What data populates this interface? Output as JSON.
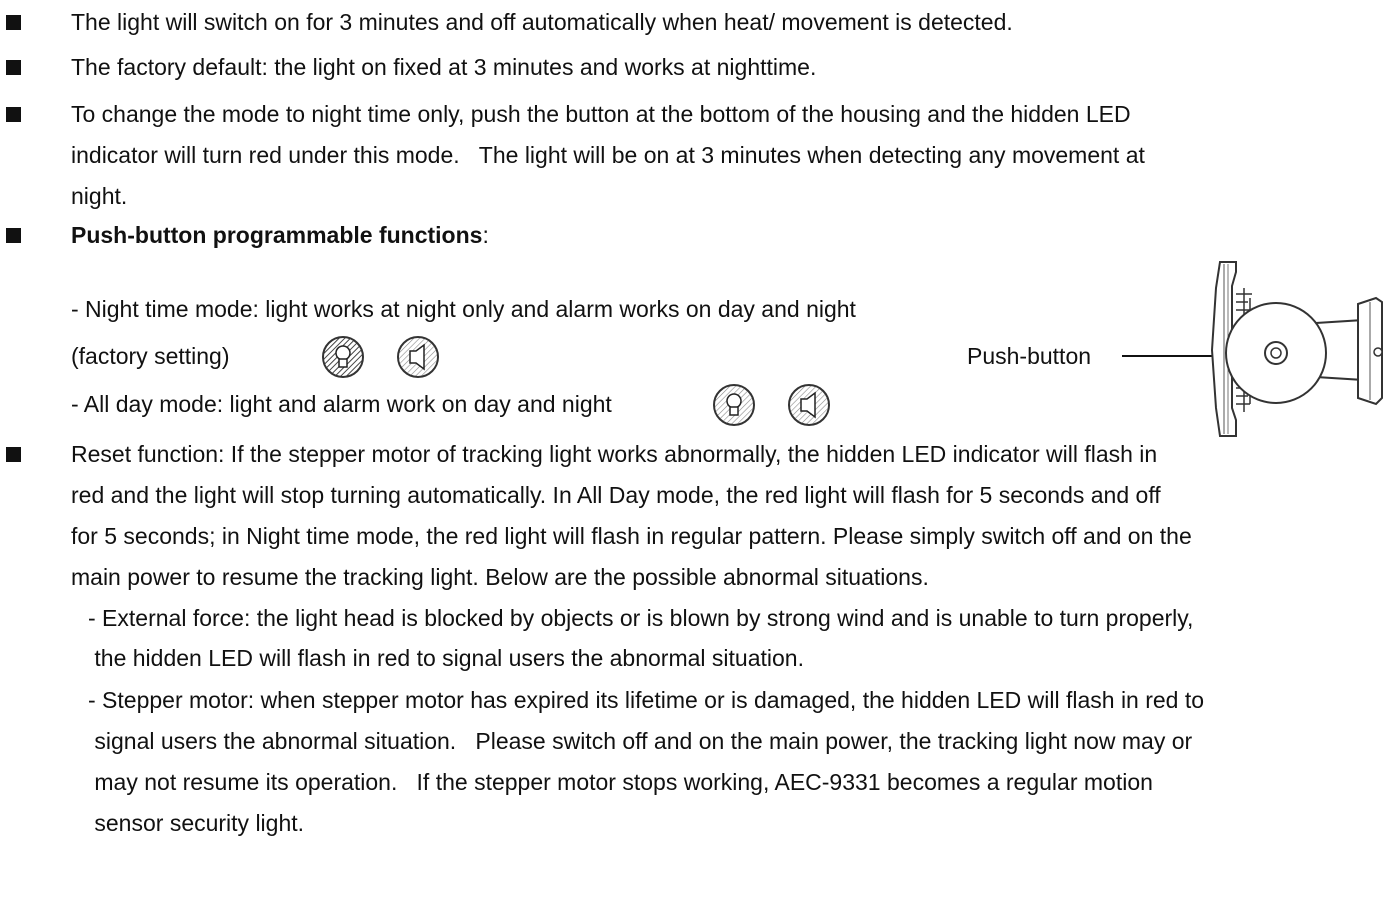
{
  "bullets": [
    {
      "lines": [
        "The light will switch on for 3 minutes and off automatically when heat/ movement is detected."
      ]
    },
    {
      "lines": [
        "The factory default: the light on fixed at 3 minutes and works at nighttime."
      ]
    },
    {
      "lines": [
        "To change the mode to night time only, push the button at the bottom of the housing and the hidden LED",
        "indicator will turn red under this mode.   The light will be on at 3 minutes when detecting any movement at",
        "night."
      ]
    },
    {
      "heading": "Push-button programmable functions",
      "heading_suffix": ":",
      "night_mode": "- Night time mode: light works at night only and alarm works on day and night",
      "factory_setting": "(factory setting)",
      "all_day_mode": "- All day mode: light and alarm work on day and night"
    },
    {
      "lines": [
        "Reset function: If the stepper motor of tracking light works abnormally, the hidden LED indicator will flash in",
        "red and the light will stop turning automatically. In All Day mode, the red light will flash for 5 seconds and off",
        "for 5 seconds; in Night time mode, the red light will flash in regular pattern. Please simply switch off and on the",
        "main power to resume the tracking light. Below are the possible abnormal situations."
      ],
      "external_force": [
        "- External force: the light head is blocked by objects or is blown by strong wind and is unable to turn properly,",
        " the hidden LED will flash in red to signal users the abnormal situation."
      ],
      "stepper_motor": [
        "- Stepper motor: when stepper motor has expired its lifetime or is damaged, the hidden LED will flash in red to",
        " signal users the abnormal situation.   Please switch off and on the main power, the tracking light now may or",
        " may not resume its operation.   If the stepper motor stops working, AEC-9331 becomes a regular motion",
        " sensor security light."
      ]
    }
  ],
  "diagram": {
    "push_button_label": "Push-button"
  },
  "icons": {
    "light": "light-bulb-icon",
    "alarm": "speaker-icon"
  }
}
